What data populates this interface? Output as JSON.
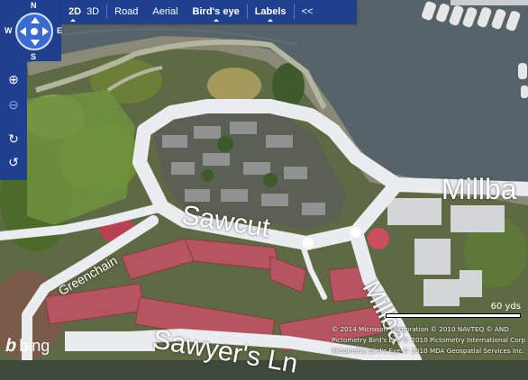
{
  "nav": {
    "compass": {
      "n": "N",
      "s": "S",
      "e": "E",
      "w": "W"
    }
  },
  "toolbar": {
    "items": [
      {
        "label": "2D",
        "active": true
      },
      {
        "label": "3D",
        "active": false
      },
      {
        "label": "Road",
        "active": false
      },
      {
        "label": "Aerial",
        "active": false
      },
      {
        "label": "Bird's eye",
        "active": true
      },
      {
        "label": "Labels",
        "active": true
      },
      {
        "label": "<<",
        "active": false
      }
    ]
  },
  "side_controls": [
    {
      "icon": "zoom-in-icon",
      "glyph": "⊕"
    },
    {
      "icon": "zoom-out-icon",
      "glyph": "⊖"
    },
    {
      "icon": "rotate-clockwise-icon",
      "glyph": "↻"
    },
    {
      "icon": "rotate-counterclockwise-icon",
      "glyph": "↺"
    }
  ],
  "map_labels": {
    "millbank": "Millba",
    "sawcut": "Sawcut",
    "greenchain": "Greenchain",
    "milbank_vertical": "Millba",
    "sawyers_ln": "Sawyer's Ln"
  },
  "scale": {
    "label": "60 yds"
  },
  "copyright": [
    "© 2014 Microsoft Corporation   © 2010 NAVTEQ   © AND",
    "Pictometry Bird's Eye © 2010 Pictometry International Corp",
    "Pictometry Bird's Eye © 2010 MDA Geospatial Services Inc."
  ],
  "logo": {
    "text": "bing"
  },
  "colors": {
    "toolbar": "#1f3f8f",
    "water": "#57646a",
    "road": "#e9edf0",
    "grass": "#6a8a3a",
    "roof_red": "#b65560"
  }
}
